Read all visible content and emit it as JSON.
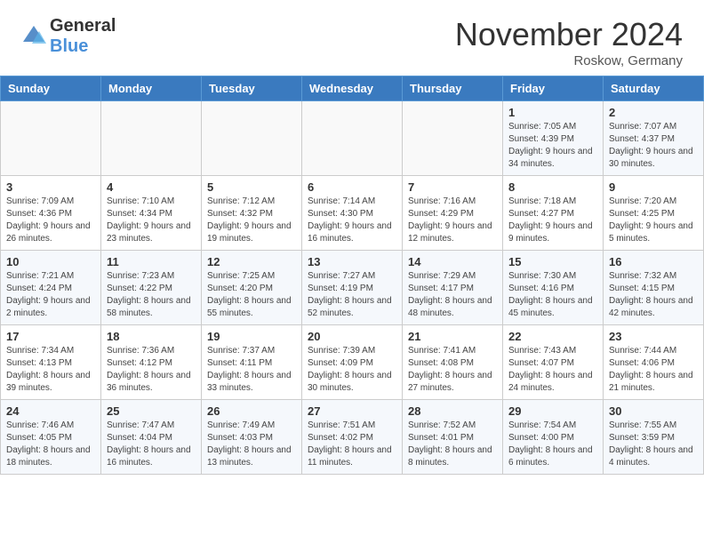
{
  "header": {
    "logo": {
      "general": "General",
      "blue": "Blue"
    },
    "title": "November 2024",
    "location": "Roskow, Germany"
  },
  "weekdays": [
    "Sunday",
    "Monday",
    "Tuesday",
    "Wednesday",
    "Thursday",
    "Friday",
    "Saturday"
  ],
  "weeks": [
    [
      {
        "day": "",
        "info": ""
      },
      {
        "day": "",
        "info": ""
      },
      {
        "day": "",
        "info": ""
      },
      {
        "day": "",
        "info": ""
      },
      {
        "day": "",
        "info": ""
      },
      {
        "day": "1",
        "info": "Sunrise: 7:05 AM\nSunset: 4:39 PM\nDaylight: 9 hours and 34 minutes."
      },
      {
        "day": "2",
        "info": "Sunrise: 7:07 AM\nSunset: 4:37 PM\nDaylight: 9 hours and 30 minutes."
      }
    ],
    [
      {
        "day": "3",
        "info": "Sunrise: 7:09 AM\nSunset: 4:36 PM\nDaylight: 9 hours and 26 minutes."
      },
      {
        "day": "4",
        "info": "Sunrise: 7:10 AM\nSunset: 4:34 PM\nDaylight: 9 hours and 23 minutes."
      },
      {
        "day": "5",
        "info": "Sunrise: 7:12 AM\nSunset: 4:32 PM\nDaylight: 9 hours and 19 minutes."
      },
      {
        "day": "6",
        "info": "Sunrise: 7:14 AM\nSunset: 4:30 PM\nDaylight: 9 hours and 16 minutes."
      },
      {
        "day": "7",
        "info": "Sunrise: 7:16 AM\nSunset: 4:29 PM\nDaylight: 9 hours and 12 minutes."
      },
      {
        "day": "8",
        "info": "Sunrise: 7:18 AM\nSunset: 4:27 PM\nDaylight: 9 hours and 9 minutes."
      },
      {
        "day": "9",
        "info": "Sunrise: 7:20 AM\nSunset: 4:25 PM\nDaylight: 9 hours and 5 minutes."
      }
    ],
    [
      {
        "day": "10",
        "info": "Sunrise: 7:21 AM\nSunset: 4:24 PM\nDaylight: 9 hours and 2 minutes."
      },
      {
        "day": "11",
        "info": "Sunrise: 7:23 AM\nSunset: 4:22 PM\nDaylight: 8 hours and 58 minutes."
      },
      {
        "day": "12",
        "info": "Sunrise: 7:25 AM\nSunset: 4:20 PM\nDaylight: 8 hours and 55 minutes."
      },
      {
        "day": "13",
        "info": "Sunrise: 7:27 AM\nSunset: 4:19 PM\nDaylight: 8 hours and 52 minutes."
      },
      {
        "day": "14",
        "info": "Sunrise: 7:29 AM\nSunset: 4:17 PM\nDaylight: 8 hours and 48 minutes."
      },
      {
        "day": "15",
        "info": "Sunrise: 7:30 AM\nSunset: 4:16 PM\nDaylight: 8 hours and 45 minutes."
      },
      {
        "day": "16",
        "info": "Sunrise: 7:32 AM\nSunset: 4:15 PM\nDaylight: 8 hours and 42 minutes."
      }
    ],
    [
      {
        "day": "17",
        "info": "Sunrise: 7:34 AM\nSunset: 4:13 PM\nDaylight: 8 hours and 39 minutes."
      },
      {
        "day": "18",
        "info": "Sunrise: 7:36 AM\nSunset: 4:12 PM\nDaylight: 8 hours and 36 minutes."
      },
      {
        "day": "19",
        "info": "Sunrise: 7:37 AM\nSunset: 4:11 PM\nDaylight: 8 hours and 33 minutes."
      },
      {
        "day": "20",
        "info": "Sunrise: 7:39 AM\nSunset: 4:09 PM\nDaylight: 8 hours and 30 minutes."
      },
      {
        "day": "21",
        "info": "Sunrise: 7:41 AM\nSunset: 4:08 PM\nDaylight: 8 hours and 27 minutes."
      },
      {
        "day": "22",
        "info": "Sunrise: 7:43 AM\nSunset: 4:07 PM\nDaylight: 8 hours and 24 minutes."
      },
      {
        "day": "23",
        "info": "Sunrise: 7:44 AM\nSunset: 4:06 PM\nDaylight: 8 hours and 21 minutes."
      }
    ],
    [
      {
        "day": "24",
        "info": "Sunrise: 7:46 AM\nSunset: 4:05 PM\nDaylight: 8 hours and 18 minutes."
      },
      {
        "day": "25",
        "info": "Sunrise: 7:47 AM\nSunset: 4:04 PM\nDaylight: 8 hours and 16 minutes."
      },
      {
        "day": "26",
        "info": "Sunrise: 7:49 AM\nSunset: 4:03 PM\nDaylight: 8 hours and 13 minutes."
      },
      {
        "day": "27",
        "info": "Sunrise: 7:51 AM\nSunset: 4:02 PM\nDaylight: 8 hours and 11 minutes."
      },
      {
        "day": "28",
        "info": "Sunrise: 7:52 AM\nSunset: 4:01 PM\nDaylight: 8 hours and 8 minutes."
      },
      {
        "day": "29",
        "info": "Sunrise: 7:54 AM\nSunset: 4:00 PM\nDaylight: 8 hours and 6 minutes."
      },
      {
        "day": "30",
        "info": "Sunrise: 7:55 AM\nSunset: 3:59 PM\nDaylight: 8 hours and 4 minutes."
      }
    ]
  ]
}
